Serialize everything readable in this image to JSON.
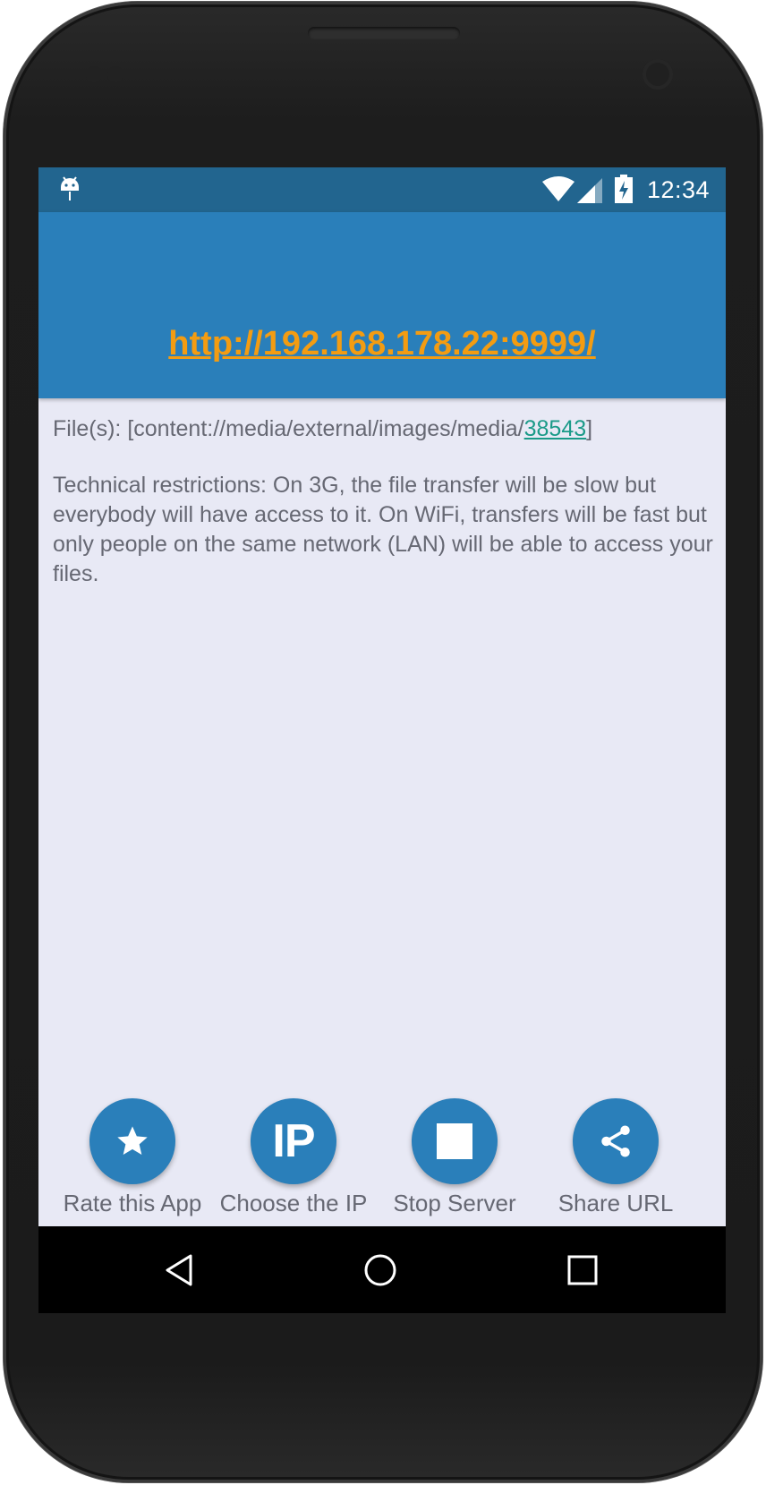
{
  "status_bar": {
    "time": "12:34",
    "icons": [
      "android-icon",
      "wifi-icon",
      "signal-icon",
      "battery-icon"
    ]
  },
  "app_bar": {
    "url": "http://192.168.178.22:9999/",
    "url_color": "#f39c12",
    "background_color": "#2a7fba"
  },
  "content": {
    "files_prefix": "File(s): [content://media/external/images/media/",
    "files_id": "38543",
    "files_suffix": "]",
    "restrictions": "Technical restrictions: On 3G, the file transfer will be slow but everybody will have access to it. On WiFi, transfers will be fast but only people on the same network (LAN) will be able to access your files."
  },
  "actions": [
    {
      "label": "Rate this App",
      "icon": "star-icon"
    },
    {
      "label": "Choose the IP",
      "icon": "ip-icon",
      "icon_text": "IP"
    },
    {
      "label": "Stop Server",
      "icon": "stop-icon"
    },
    {
      "label": "Share URL",
      "icon": "share-icon"
    }
  ],
  "nav_bar": {
    "buttons": [
      "back-icon",
      "home-icon",
      "recents-icon"
    ]
  }
}
